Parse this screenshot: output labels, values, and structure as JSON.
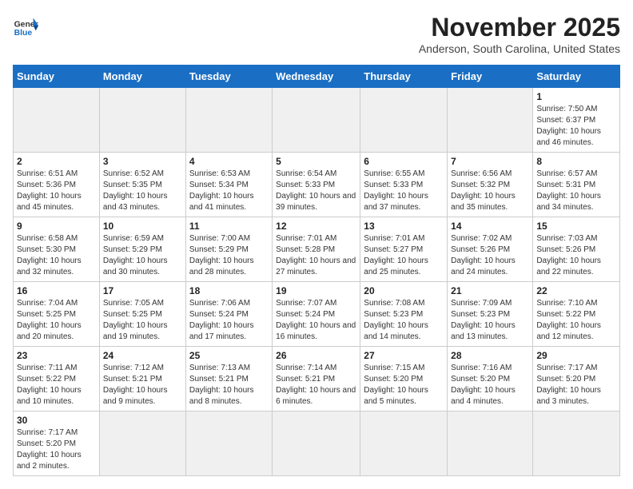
{
  "header": {
    "logo_general": "General",
    "logo_blue": "Blue",
    "month_title": "November 2025",
    "location": "Anderson, South Carolina, United States"
  },
  "weekdays": [
    "Sunday",
    "Monday",
    "Tuesday",
    "Wednesday",
    "Thursday",
    "Friday",
    "Saturday"
  ],
  "weeks": [
    [
      {
        "day": "",
        "empty": true
      },
      {
        "day": "",
        "empty": true
      },
      {
        "day": "",
        "empty": true
      },
      {
        "day": "",
        "empty": true
      },
      {
        "day": "",
        "empty": true
      },
      {
        "day": "",
        "empty": true
      },
      {
        "day": "1",
        "sunrise": "7:50 AM",
        "sunset": "6:37 PM",
        "daylight": "10 hours and 46 minutes."
      }
    ],
    [
      {
        "day": "2",
        "sunrise": "6:51 AM",
        "sunset": "5:36 PM",
        "daylight": "10 hours and 45 minutes."
      },
      {
        "day": "3",
        "sunrise": "6:52 AM",
        "sunset": "5:35 PM",
        "daylight": "10 hours and 43 minutes."
      },
      {
        "day": "4",
        "sunrise": "6:53 AM",
        "sunset": "5:34 PM",
        "daylight": "10 hours and 41 minutes."
      },
      {
        "day": "5",
        "sunrise": "6:54 AM",
        "sunset": "5:33 PM",
        "daylight": "10 hours and 39 minutes."
      },
      {
        "day": "6",
        "sunrise": "6:55 AM",
        "sunset": "5:33 PM",
        "daylight": "10 hours and 37 minutes."
      },
      {
        "day": "7",
        "sunrise": "6:56 AM",
        "sunset": "5:32 PM",
        "daylight": "10 hours and 35 minutes."
      },
      {
        "day": "8",
        "sunrise": "6:57 AM",
        "sunset": "5:31 PM",
        "daylight": "10 hours and 34 minutes."
      }
    ],
    [
      {
        "day": "9",
        "sunrise": "6:58 AM",
        "sunset": "5:30 PM",
        "daylight": "10 hours and 32 minutes."
      },
      {
        "day": "10",
        "sunrise": "6:59 AM",
        "sunset": "5:29 PM",
        "daylight": "10 hours and 30 minutes."
      },
      {
        "day": "11",
        "sunrise": "7:00 AM",
        "sunset": "5:29 PM",
        "daylight": "10 hours and 28 minutes."
      },
      {
        "day": "12",
        "sunrise": "7:01 AM",
        "sunset": "5:28 PM",
        "daylight": "10 hours and 27 minutes."
      },
      {
        "day": "13",
        "sunrise": "7:01 AM",
        "sunset": "5:27 PM",
        "daylight": "10 hours and 25 minutes."
      },
      {
        "day": "14",
        "sunrise": "7:02 AM",
        "sunset": "5:26 PM",
        "daylight": "10 hours and 24 minutes."
      },
      {
        "day": "15",
        "sunrise": "7:03 AM",
        "sunset": "5:26 PM",
        "daylight": "10 hours and 22 minutes."
      }
    ],
    [
      {
        "day": "16",
        "sunrise": "7:04 AM",
        "sunset": "5:25 PM",
        "daylight": "10 hours and 20 minutes."
      },
      {
        "day": "17",
        "sunrise": "7:05 AM",
        "sunset": "5:25 PM",
        "daylight": "10 hours and 19 minutes."
      },
      {
        "day": "18",
        "sunrise": "7:06 AM",
        "sunset": "5:24 PM",
        "daylight": "10 hours and 17 minutes."
      },
      {
        "day": "19",
        "sunrise": "7:07 AM",
        "sunset": "5:24 PM",
        "daylight": "10 hours and 16 minutes."
      },
      {
        "day": "20",
        "sunrise": "7:08 AM",
        "sunset": "5:23 PM",
        "daylight": "10 hours and 14 minutes."
      },
      {
        "day": "21",
        "sunrise": "7:09 AM",
        "sunset": "5:23 PM",
        "daylight": "10 hours and 13 minutes."
      },
      {
        "day": "22",
        "sunrise": "7:10 AM",
        "sunset": "5:22 PM",
        "daylight": "10 hours and 12 minutes."
      }
    ],
    [
      {
        "day": "23",
        "sunrise": "7:11 AM",
        "sunset": "5:22 PM",
        "daylight": "10 hours and 10 minutes."
      },
      {
        "day": "24",
        "sunrise": "7:12 AM",
        "sunset": "5:21 PM",
        "daylight": "10 hours and 9 minutes."
      },
      {
        "day": "25",
        "sunrise": "7:13 AM",
        "sunset": "5:21 PM",
        "daylight": "10 hours and 8 minutes."
      },
      {
        "day": "26",
        "sunrise": "7:14 AM",
        "sunset": "5:21 PM",
        "daylight": "10 hours and 6 minutes."
      },
      {
        "day": "27",
        "sunrise": "7:15 AM",
        "sunset": "5:20 PM",
        "daylight": "10 hours and 5 minutes."
      },
      {
        "day": "28",
        "sunrise": "7:16 AM",
        "sunset": "5:20 PM",
        "daylight": "10 hours and 4 minutes."
      },
      {
        "day": "29",
        "sunrise": "7:17 AM",
        "sunset": "5:20 PM",
        "daylight": "10 hours and 3 minutes."
      }
    ],
    [
      {
        "day": "30",
        "sunrise": "7:17 AM",
        "sunset": "5:20 PM",
        "daylight": "10 hours and 2 minutes."
      },
      {
        "day": "",
        "empty": true
      },
      {
        "day": "",
        "empty": true
      },
      {
        "day": "",
        "empty": true
      },
      {
        "day": "",
        "empty": true
      },
      {
        "day": "",
        "empty": true
      },
      {
        "day": "",
        "empty": true
      }
    ]
  ]
}
